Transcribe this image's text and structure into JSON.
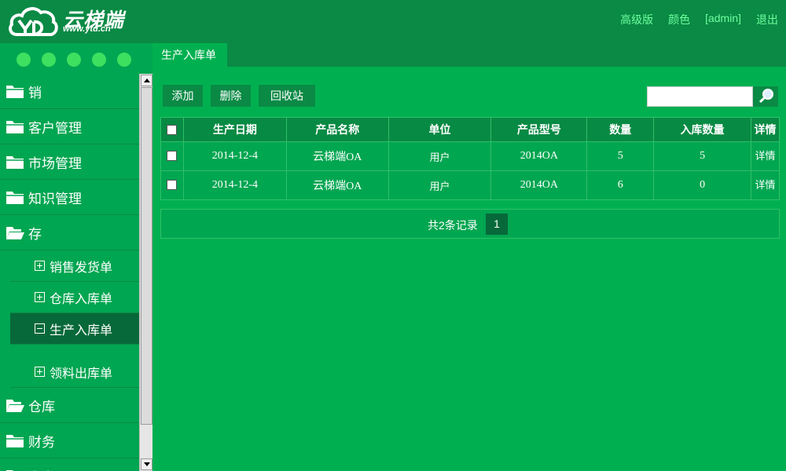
{
  "header": {
    "logo_name": "云梯端",
    "logo_url": "www.ytd.cn",
    "links": [
      "高级版",
      "颜色",
      "[admin]",
      "退出"
    ]
  },
  "sidebar": {
    "items": [
      {
        "label": "销",
        "open": false
      },
      {
        "label": "客户管理",
        "open": false
      },
      {
        "label": "市场管理",
        "open": false
      },
      {
        "label": "知识管理",
        "open": false
      },
      {
        "label": "存",
        "open": true
      }
    ],
    "sub_items": [
      {
        "label": "销售发货单",
        "expander": "plus"
      },
      {
        "label": "仓库入库单",
        "expander": "plus"
      },
      {
        "label": "生产入库单",
        "expander": "minus",
        "active": true
      },
      {
        "label": "领料出库单",
        "expander": "plus"
      }
    ],
    "items_after": [
      {
        "label": "仓库"
      },
      {
        "label": "财务"
      },
      {
        "label": "生产"
      }
    ]
  },
  "tab": {
    "label": "生产入库单"
  },
  "toolbar": {
    "add": "添加",
    "delete": "删除",
    "recycle": "回收站"
  },
  "search": {
    "placeholder": ""
  },
  "table": {
    "headers": [
      "生产日期",
      "产品名称",
      "单位",
      "产品型号",
      "数量",
      "入库数量",
      "详情"
    ],
    "rows": [
      {
        "date": "2014-12-4",
        "product": "云梯端OA",
        "unit": "用户",
        "model": "2014OA",
        "qty": "5",
        "in_qty": "5",
        "detail": "详情"
      },
      {
        "date": "2014-12-4",
        "product": "云梯端OA",
        "unit": "用户",
        "model": "2014OA",
        "qty": "6",
        "in_qty": "0",
        "detail": "详情"
      }
    ]
  },
  "pager": {
    "summary": "共2条记录",
    "page": "1"
  },
  "colors": {
    "accent": "#00b050",
    "dark": "#0a8a45",
    "link": "#6dff9d",
    "active": "#07693a"
  }
}
